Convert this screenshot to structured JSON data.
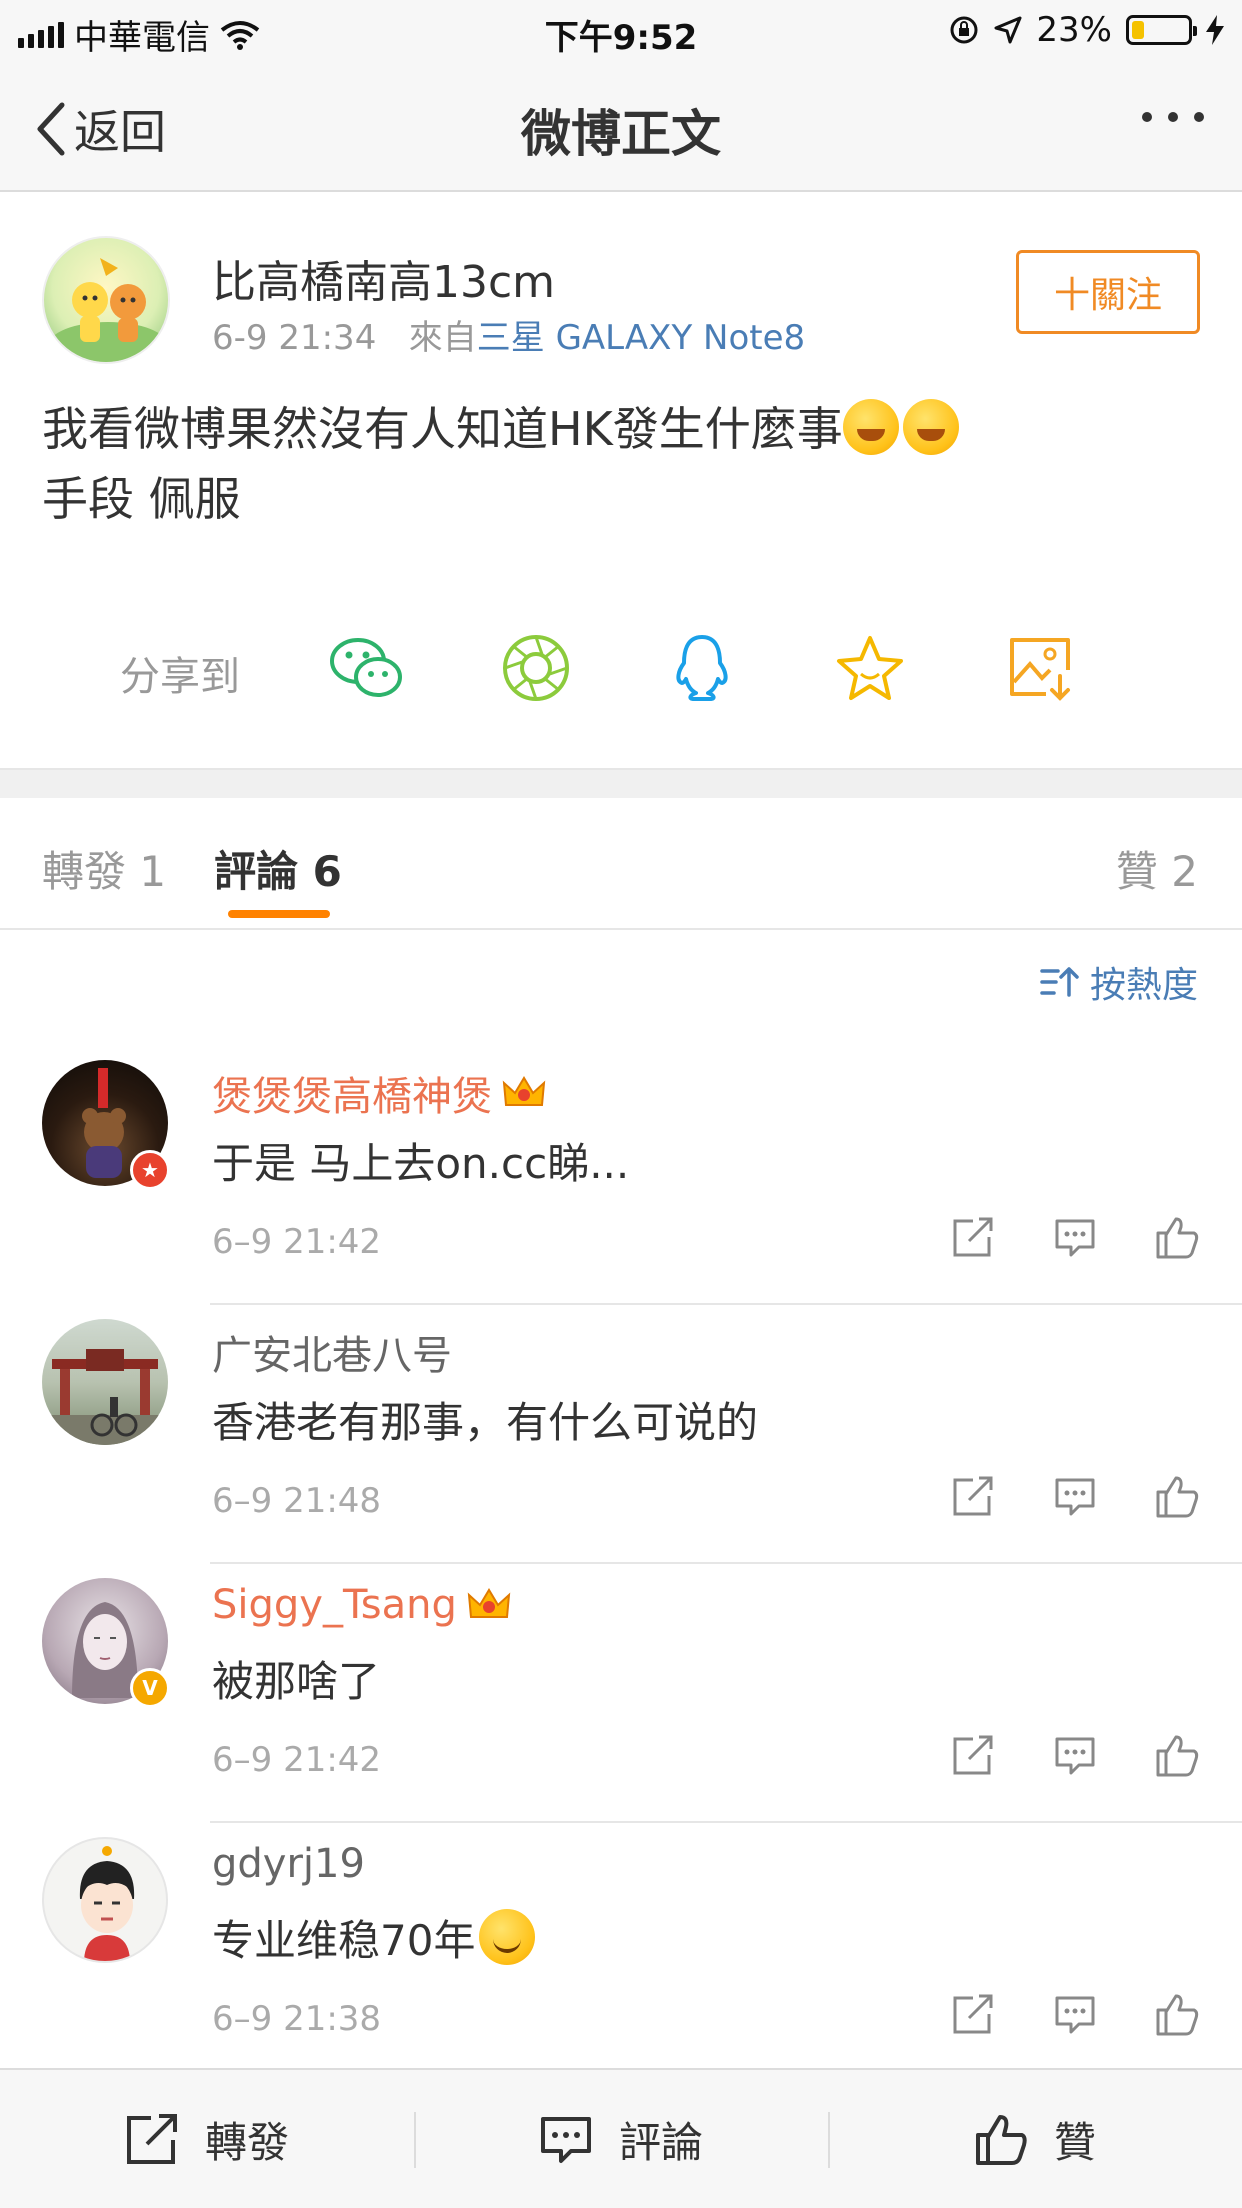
{
  "status_bar": {
    "carrier": "中華電信",
    "time": "下午9:52",
    "battery": "23%",
    "battery_level": 0.23
  },
  "nav": {
    "back_label": "返回",
    "title": "微博正文"
  },
  "post": {
    "author": "比高橋南高13cm",
    "time": "6-9 21:34",
    "source_prefix": "來自",
    "source": "三星 GALAXY Note8",
    "follow_label": "十關注",
    "text_line1": "我看微博果然沒有人知道HK發生什麼事",
    "text_line2": "手段 佩服",
    "share_label": "分享到",
    "share_targets": [
      "wechat-icon",
      "moments-icon",
      "qq-icon",
      "favorite-icon",
      "save-image-icon"
    ]
  },
  "tabs": {
    "repost": "轉發 1",
    "comments": "評論 6",
    "likes": "贊 2"
  },
  "sort_label": "按熱度",
  "comments": [
    {
      "user": "煲煲煲高橋神煲",
      "text": "于是 马上去on.cc睇...",
      "time": "6–9 21:42"
    },
    {
      "user": "广安北巷八号",
      "text": "香港老有那事，有什么可说的",
      "time": "6–9 21:48"
    },
    {
      "user": "Siggy_Tsang",
      "text": "被那啥了",
      "time": "6–9 21:42"
    },
    {
      "user": "gdyrj19",
      "text": "专业维稳70年",
      "time": "6–9 21:38"
    }
  ],
  "bottom_bar": {
    "repost": "轉發",
    "comment": "評論",
    "like": "贊"
  },
  "colors": {
    "accent_orange": "#ff8200",
    "link_blue": "#4a7db5",
    "vip_name": "#eb7350"
  }
}
